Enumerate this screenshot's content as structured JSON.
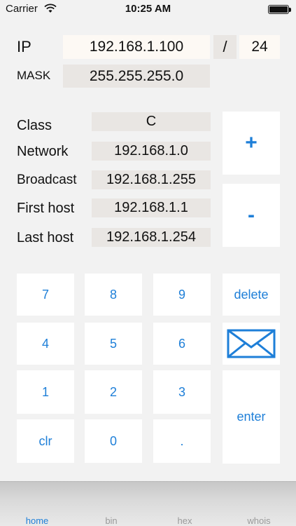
{
  "status_bar": {
    "carrier": "Carrier",
    "time": "10:25 AM"
  },
  "form": {
    "ip_label": "IP",
    "ip_value": "192.168.1.100",
    "slash": "/",
    "prefix": "24",
    "mask_label": "MASK",
    "mask_value": "255.255.255.0"
  },
  "results": {
    "class_label": "Class",
    "class_value": "C",
    "network_label": "Network",
    "network_value": "192.168.1.0",
    "broadcast_label": "Broadcast",
    "broadcast_value": "192.168.1.255",
    "first_label": "First host",
    "first_value": "192.168.1.1",
    "last_label": "Last host",
    "last_value": "192.168.1.254"
  },
  "side_buttons": {
    "plus": "+",
    "minus": "-"
  },
  "keypad": {
    "k7": "7",
    "k8": "8",
    "k9": "9",
    "delete": "delete",
    "k4": "4",
    "k5": "5",
    "k6": "6",
    "k1": "1",
    "k2": "2",
    "k3": "3",
    "enter": "enter",
    "clr": "clr",
    "k0": "0",
    "dot": "."
  },
  "tabs": [
    "home",
    "bin",
    "hex",
    "whois"
  ],
  "colors": {
    "accent": "#1e7fd8",
    "field_bg": "#e9e6e3",
    "input_bg": "#fdf9f4",
    "background": "#f2f2f2"
  },
  "icons": {
    "mail": "envelope-icon",
    "wifi": "wifi-icon",
    "battery": "battery-icon"
  }
}
